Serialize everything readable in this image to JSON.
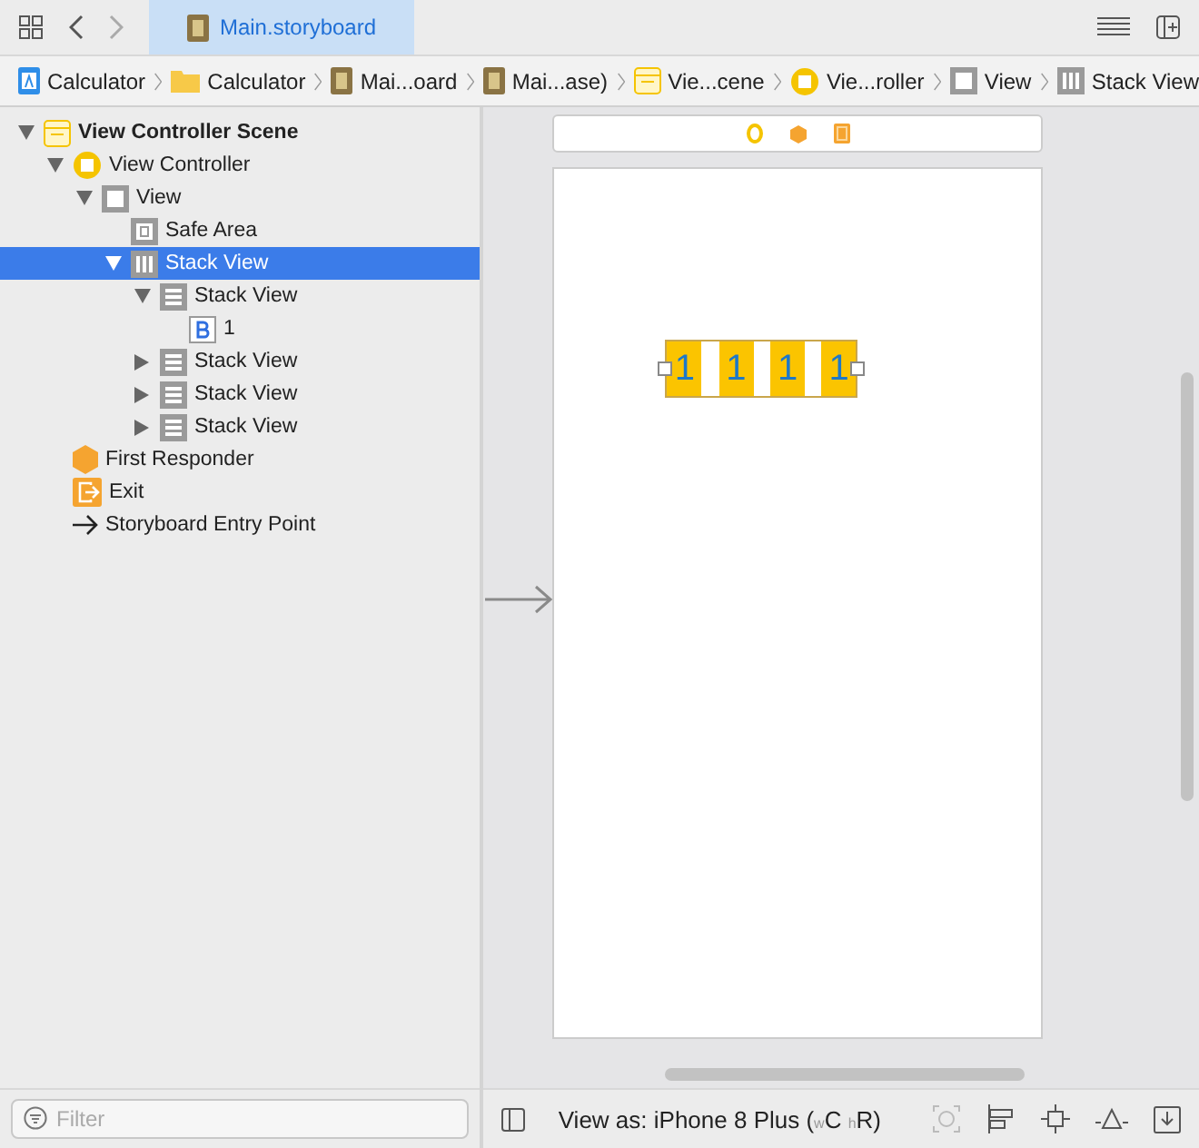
{
  "editor_tab": {
    "title": "Main.storyboard",
    "selected": true
  },
  "breadcrumb": [
    {
      "kind": "project",
      "label": "Calculator"
    },
    {
      "kind": "folder",
      "label": "Calculator"
    },
    {
      "kind": "storyboard",
      "label": "Mai...oard"
    },
    {
      "kind": "storyboard",
      "label": "Mai...ase)"
    },
    {
      "kind": "scene",
      "label": "Vie...cene"
    },
    {
      "kind": "controller",
      "label": "Vie...roller"
    },
    {
      "kind": "view",
      "label": "View"
    },
    {
      "kind": "hstack",
      "label": "Stack View"
    }
  ],
  "outline": [
    {
      "kind": "scene",
      "label": "View Controller Scene",
      "expanded": true,
      "selected": false,
      "children": [
        {
          "kind": "controller",
          "label": "View Controller",
          "expanded": true,
          "selected": false,
          "children": [
            {
              "kind": "view",
              "label": "View",
              "expanded": true,
              "selected": false,
              "children": [
                {
                  "kind": "safe-area",
                  "label": "Safe Area",
                  "selected": false
                },
                {
                  "kind": "hstack",
                  "label": "Stack View",
                  "expanded": true,
                  "selected": true,
                  "children": [
                    {
                      "kind": "vstack",
                      "label": "Stack View",
                      "expanded": true,
                      "selected": false,
                      "children": [
                        {
                          "kind": "button",
                          "label": "1",
                          "selected": false
                        }
                      ]
                    },
                    {
                      "kind": "vstack",
                      "label": "Stack View",
                      "expanded": false,
                      "selected": false
                    },
                    {
                      "kind": "vstack",
                      "label": "Stack View",
                      "expanded": false,
                      "selected": false
                    },
                    {
                      "kind": "vstack",
                      "label": "Stack View",
                      "expanded": false,
                      "selected": false
                    }
                  ]
                }
              ]
            }
          ]
        },
        {
          "kind": "responder",
          "label": "First Responder",
          "selected": false
        },
        {
          "kind": "exit",
          "label": "Exit",
          "selected": false
        },
        {
          "kind": "entry",
          "label": "Storyboard Entry Point",
          "selected": false
        }
      ]
    }
  ],
  "filter": {
    "placeholder": "Filter"
  },
  "canvas": {
    "buttons": [
      "1",
      "1",
      "1",
      "1"
    ]
  },
  "bottom_bar": {
    "view_as": "View as: iPhone 8 Plus ($_{w}$C $_{h}$R)"
  }
}
